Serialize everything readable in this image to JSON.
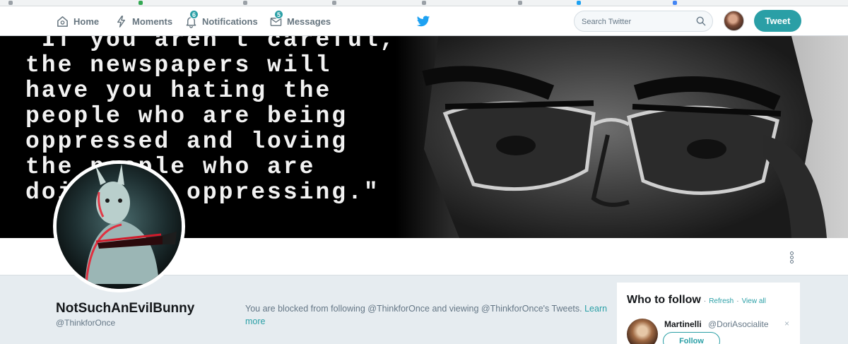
{
  "nav": {
    "home_label": "Home",
    "moments_label": "Moments",
    "notifications_label": "Notifications",
    "notifications_count": "6",
    "messages_label": "Messages",
    "messages_count": "5",
    "search_placeholder": "Search Twitter",
    "tweet_label": "Tweet",
    "icons": [
      "home-icon",
      "lightning-icon",
      "bell-icon",
      "envelope-icon",
      "twitter-bird-icon",
      "search-icon"
    ]
  },
  "banner": {
    "quote_lines": [
      "\"If you aren't careful,",
      "the newspapers will",
      "have you hating the",
      "people who are being",
      "oppressed and loving",
      "the people who are",
      "doing the oppressing.\""
    ]
  },
  "profile": {
    "display_name": "NotSuchAnEvilBunny",
    "handle": "@ThinkforOnce",
    "blocked_message": "You are blocked from following @ThinkforOnce and viewing @ThinkforOnce's Tweets.",
    "learn_more": "Learn more"
  },
  "who_to_follow": {
    "title": "Who to follow",
    "separator": "·",
    "refresh": "Refresh",
    "view_all": "View all",
    "suggestion": {
      "name": "Martinelli",
      "handle": "@DoriAsocialite",
      "close": "×",
      "follow_label": "Follow"
    }
  },
  "colors": {
    "accent": "#2a9fa6",
    "text_primary": "#14171a",
    "text_secondary": "#657786",
    "page_bg": "#e6ecf0"
  }
}
